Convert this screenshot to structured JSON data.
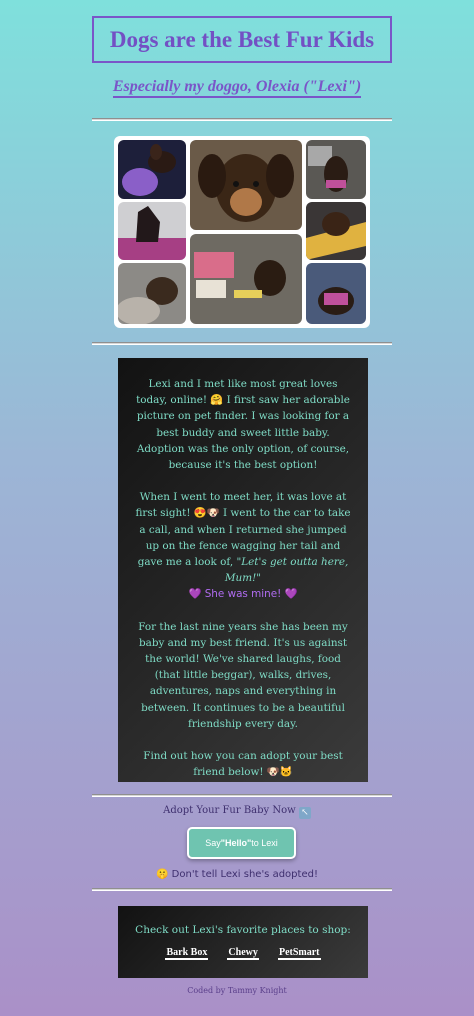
{
  "header": {
    "title": "Dogs are the Best Fur Kids",
    "subtitle": "Especially my doggo, Olexia (\"Lexi\")"
  },
  "story": {
    "p1": "Lexi and I met like most great loves today, online! 🤗 I first saw her adorable picture on pet finder. I was looking for a best buddy and sweet little baby. Adoption was the only option, of course, because it's the best option!",
    "p2_text": "When I went to meet her, it was love at first sight! 😍🐶 I went to the car to take a call, and when I returned she jumped up on the fence wagging her tail and gave me a look of,",
    "p2_quote": "\"Let's get outta here, Mum!\"",
    "p2_mine": "💜 She was mine! 💜",
    "p3": "For the last nine years she has been my baby and my best friend. It's us against the world! We've shared laughs, food (that little beggar), walks, drives, adventures, naps and everything in between. It continues to be a beautiful friendship every day.",
    "p4": "Find out how you can adopt your best friend below! 🐶🐱"
  },
  "adopt": {
    "label": "Adopt Your Fur Baby Now",
    "icon": "arrow-up-left-icon",
    "button_prefix": "Say ",
    "button_bold": "\"Hello\"",
    "button_suffix": " to Lexi",
    "secret": "🤫 Don't tell Lexi she's adopted!"
  },
  "shop": {
    "title": "Check out Lexi's favorite places to shop:",
    "links": [
      "Bark Box",
      "Chewy",
      "PetSmart"
    ]
  },
  "credit": "Coded by Tammy Knight",
  "colors": {
    "accent_purple": "#7350c4",
    "teal_text": "#7fdcc6",
    "button_teal": "#6fc4b0",
    "heart_purple": "#b06cf0"
  }
}
